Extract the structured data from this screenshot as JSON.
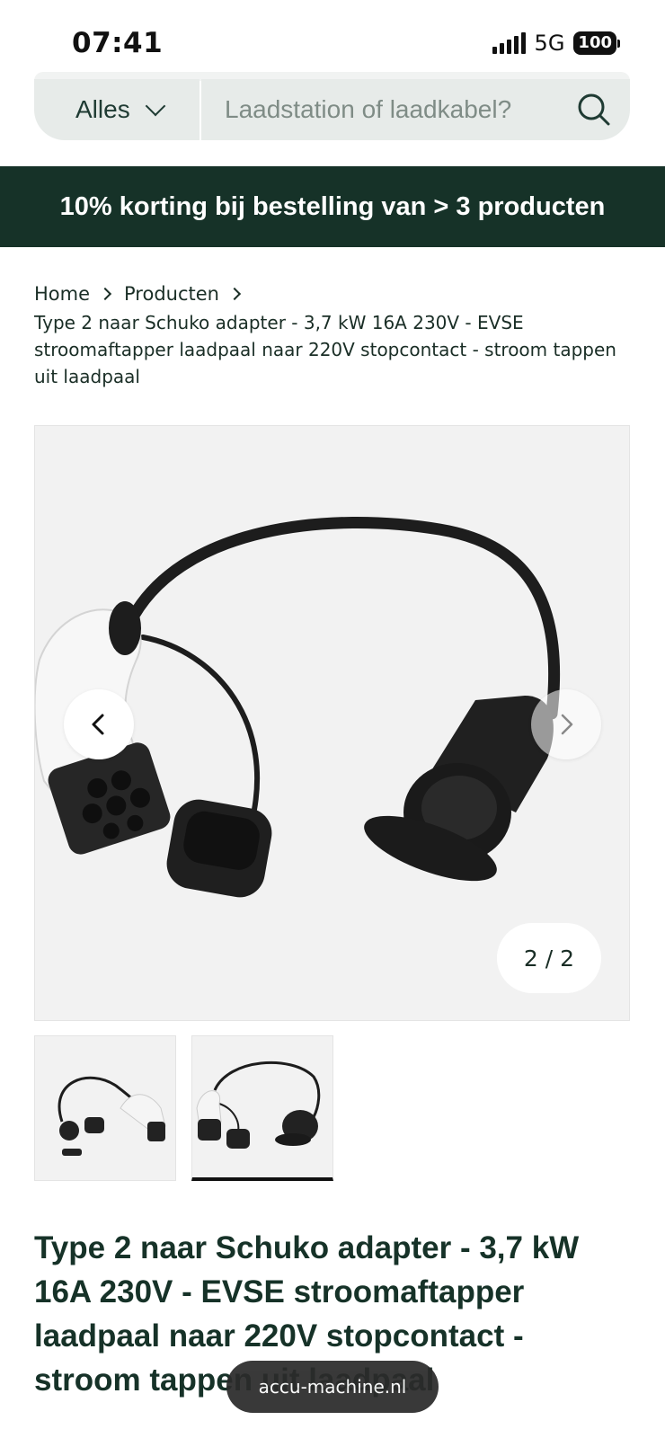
{
  "status_bar": {
    "time": "07:41",
    "network": "5G",
    "battery": "100"
  },
  "search": {
    "category_label": "Alles",
    "placeholder": "Laadstation of laadkabel?"
  },
  "promo": {
    "text": "10% korting bij bestelling van > 3 producten",
    "background": "#163228"
  },
  "breadcrumb": {
    "items": [
      "Home",
      "Producten"
    ],
    "current": "Type 2 naar Schuko adapter - 3,7 kW 16A 230V - EVSE stroomaftapper laadpaal naar 220V stopcontact - stroom tappen uit laadpaal"
  },
  "gallery": {
    "counter": "2 / 2",
    "active_index": 2,
    "total": 2,
    "icons": {
      "prev": "chevron-left-icon",
      "next": "chevron-right-icon"
    }
  },
  "product": {
    "title": "Type 2 naar Schuko adapter - 3,7 kW 16A 230V - EVSE stroomaftapper laadpaal naar 220V stopcontact - stroom tappen uit laadpaal"
  },
  "browser": {
    "url": "accu-machine.nl"
  }
}
